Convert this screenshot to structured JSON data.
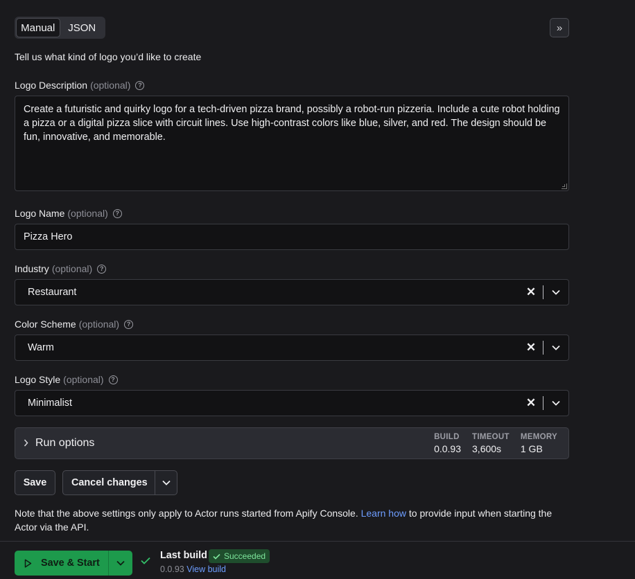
{
  "tabs": {
    "manual": "Manual",
    "json": "JSON"
  },
  "intro": "Tell us what kind of logo you’d like to create",
  "optional": "(optional)",
  "fields": {
    "description": {
      "label": "Logo Description",
      "value": "Create a futuristic and quirky logo for a tech-driven pizza brand, possibly a robot-run pizzeria. Include a cute robot holding a pizza or a digital pizza slice with circuit lines. Use high-contrast colors like blue, silver, and red. The design should be fun, innovative, and memorable."
    },
    "name": {
      "label": "Logo Name",
      "value": "Pizza Hero"
    },
    "industry": {
      "label": "Industry",
      "value": "Restaurant"
    },
    "color_scheme": {
      "label": "Color Scheme",
      "value": "Warm"
    },
    "style": {
      "label": "Logo Style",
      "value": "Minimalist"
    }
  },
  "run_options": {
    "title": "Run options",
    "build_label": "BUILD",
    "build_value": "0.0.93",
    "timeout_label": "TIMEOUT",
    "timeout_value": "3,600s",
    "memory_label": "MEMORY",
    "memory_value": "1 GB"
  },
  "buttons": {
    "save": "Save",
    "cancel": "Cancel changes",
    "save_start": "Save & Start"
  },
  "note": {
    "before": "Note that the above settings only apply to Actor runs started from Apify Console. ",
    "link": "Learn how",
    "after": " to provide input when starting the Actor via the API."
  },
  "last_build": {
    "title": "Last build",
    "status": "Succeeded",
    "version": "0.0.93",
    "view_link": "View build"
  },
  "colors": {
    "accent_green": "#1d9a4c",
    "link": "#6d9dff",
    "success_badge": "#1f4d2d"
  },
  "icons": [
    "chevrons-right-icon",
    "help-circle-icon",
    "clear-x-icon",
    "chevron-down-icon",
    "chevron-right-icon",
    "play-icon",
    "check-icon"
  ]
}
